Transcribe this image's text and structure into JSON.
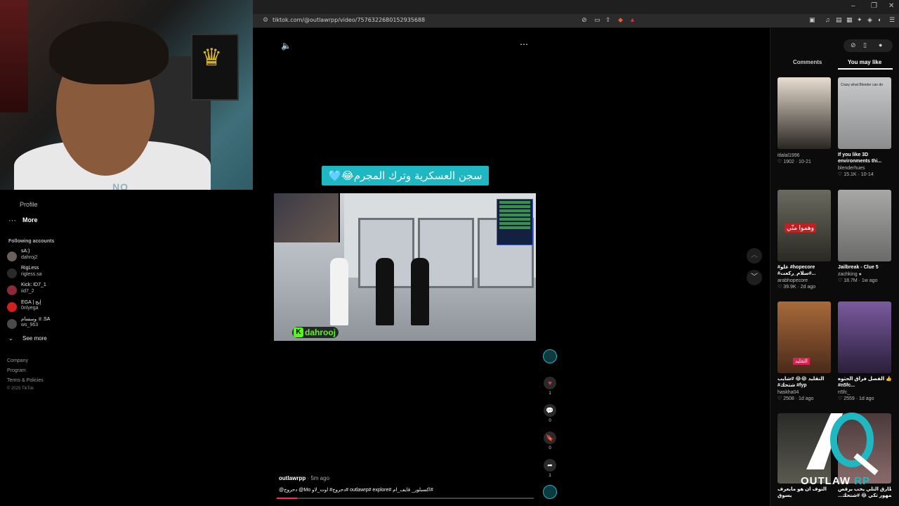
{
  "browser": {
    "url": "tiktok.com/@outlawrpp/video/7576322680152935688",
    "window_controls": {
      "minimize": "–",
      "restore": "❐",
      "close": "✕"
    }
  },
  "webcam": {
    "overlay_tag": "NO"
  },
  "sidebar": {
    "partial_item": "Profile",
    "more_label": "More",
    "following_title": "Following accounts",
    "accounts": [
      {
        "name": "sA:)",
        "handle": "dahroj2"
      },
      {
        "name": "RigLess",
        "handle": "rigless.sa"
      },
      {
        "name": "Kick: ID7_1",
        "handle": "iid7_2"
      },
      {
        "name": "EGA | إيج",
        "handle": "0nlyega"
      },
      {
        "name": "وسسام ♕.SA",
        "handle": "ws_963"
      }
    ],
    "see_more": "See more",
    "footer": [
      "Company",
      "Program",
      "Terms & Policies",
      "© 2025 TikTok"
    ]
  },
  "video": {
    "caption_banner": "سجن العسكرية وترك المجرم😂🩵",
    "kick_tag": "dahrooj",
    "author": "outlawrpp",
    "posted_ago": "· 5m ago",
    "description": "@دحروج @Mo دحروج# اوت_لاو# outlawrp# explore# اكسبلور_ قايف_ام#",
    "progress": 0.08
  },
  "actions": {
    "likes": "1",
    "comments": "0",
    "saves": "0",
    "shares": "1"
  },
  "right_panel": {
    "tabs": [
      "Comments",
      "You may like"
    ],
    "active_tab": "You may like",
    "cards": [
      {
        "title1": "",
        "title2": "",
        "user": "itlalal1996",
        "stats": "♡ 1902 · 10-21",
        "thumb_color": "#e8ded0",
        "overlay": ""
      },
      {
        "title1": "If you like 3D",
        "title2": "environments thi...",
        "user": "blenderhues",
        "stats": "♡ 15.1K · 10-14",
        "thumb_color": "#d8dadc",
        "overlay": "Crazy what Blender can do"
      },
      {
        "title1": "#غلو #hopecore",
        "title2": "#سلام_ركعت#...",
        "user": "arabhopecore",
        "stats": "♡ 39.9K · 2d ago",
        "thumb_color": "#4a4a40",
        "overlay": "وهموا منّي"
      },
      {
        "title1": "Jailbreak - Clue 5",
        "title2": "",
        "user": "zachking ●",
        "stats": "♡ 18.7M · 1w ago",
        "thumb_color": "#8c8c8a",
        "overlay": ""
      },
      {
        "title1": "التقليد 😂😂 #شايب",
        "title2": "#شتحك #fyp",
        "user": "haskha04",
        "stats": "♡ 2508 · 1d ago",
        "thumb_color": "#8a4a2a",
        "overlay": "التقليد"
      },
      {
        "title1": "الفصل فراق الحثوه 👍",
        "title2": "#n5fc...",
        "user": "n5fc_",
        "stats": "♡ 2559 · 1d ago",
        "thumb_color": "#5a3f7a",
        "overlay": ""
      },
      {
        "title1": "التوف ان هو مايعرف",
        "title2": "يسوق",
        "user": "",
        "stats": "",
        "thumb_color": "#3a3a38",
        "overlay": ""
      },
      {
        "title1": "طارق التلي يحب برقص",
        "title2": "...جمهور تكي 😂 #شتحك",
        "user": "",
        "stats": "",
        "thumb_color": "#6a4a4a",
        "overlay": ""
      }
    ]
  },
  "watermark": {
    "brand": "OUTLAW",
    "suffix": "RP"
  }
}
